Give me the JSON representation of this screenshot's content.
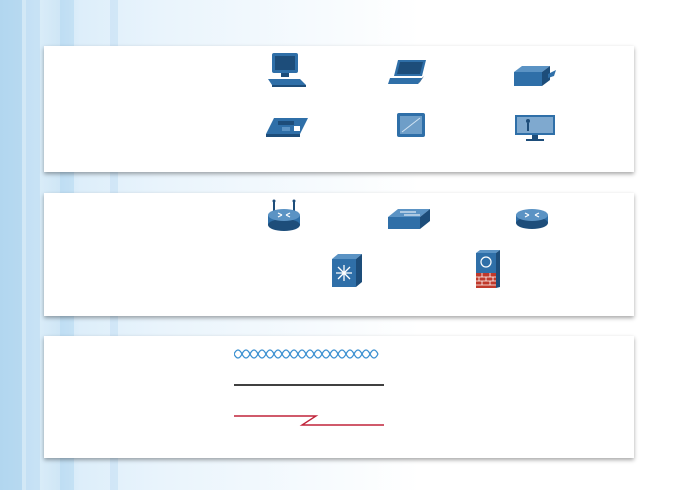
{
  "panels": [
    {
      "id": "end-devices",
      "icons": [
        "desktop-computer-icon",
        "laptop-icon",
        "server-icon",
        "ip-phone-icon",
        "tablet-icon",
        "tv-display-icon"
      ]
    },
    {
      "id": "intermediary-devices",
      "icons": [
        "wireless-router-icon",
        "lan-switch-icon",
        "router-icon",
        "multilayer-switch-icon",
        "firewall-icon"
      ]
    },
    {
      "id": "network-media",
      "icons": [
        "wireless-media-icon",
        "lan-media-icon",
        "wan-media-icon"
      ]
    }
  ],
  "colors": {
    "device_blue": "#2f6fa8",
    "device_dark": "#1d4d7a",
    "wireless_wave": "#3a8fd0",
    "lan_line": "#000000",
    "wan_line": "#c0233a",
    "firewall_red": "#c0392b"
  }
}
